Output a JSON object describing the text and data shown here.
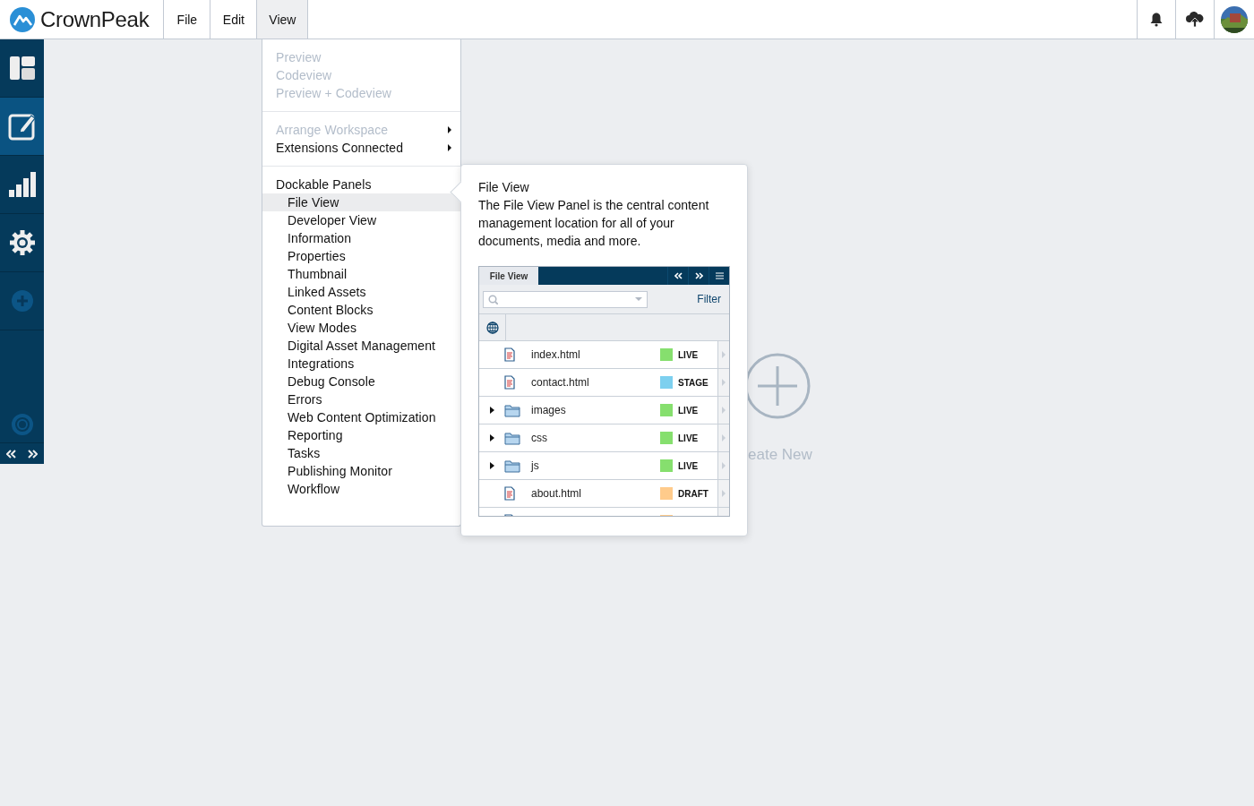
{
  "topbar": {
    "brand": "CrownPeak",
    "menus": [
      {
        "label": "File",
        "selected": false
      },
      {
        "label": "Edit",
        "selected": false
      },
      {
        "label": "View",
        "selected": true
      }
    ]
  },
  "sidebar": {
    "items": [
      {
        "kind": "dashboard",
        "selected": false
      },
      {
        "kind": "edit",
        "selected": true
      },
      {
        "kind": "analytics",
        "selected": false
      },
      {
        "kind": "settings",
        "selected": false
      },
      {
        "kind": "add",
        "selected": false
      }
    ]
  },
  "view_menu": {
    "sections": [
      {
        "items": [
          {
            "label": "Preview",
            "disabled": true,
            "submenu": false,
            "selected": false
          },
          {
            "label": "Codeview",
            "disabled": true,
            "submenu": false,
            "selected": false
          },
          {
            "label": "Preview + Codeview",
            "disabled": true,
            "submenu": false,
            "selected": false
          }
        ]
      },
      {
        "items": [
          {
            "label": "Arrange Workspace",
            "disabled": true,
            "submenu": true,
            "selected": false
          },
          {
            "label": "Extensions Connected",
            "disabled": false,
            "submenu": true,
            "selected": false
          }
        ]
      },
      {
        "items": [
          {
            "label": "Dockable Panels",
            "disabled": false,
            "submenu": false,
            "selected": false,
            "children": [
              {
                "label": "File View",
                "disabled": false,
                "submenu": false,
                "selected": true
              },
              {
                "label": "Developer View",
                "disabled": false,
                "submenu": false,
                "selected": false
              },
              {
                "label": "Information",
                "disabled": false,
                "submenu": false,
                "selected": false
              },
              {
                "label": "Properties",
                "disabled": false,
                "submenu": false,
                "selected": false
              },
              {
                "label": "Thumbnail",
                "disabled": false,
                "submenu": false,
                "selected": false
              },
              {
                "label": "Linked Assets",
                "disabled": false,
                "submenu": false,
                "selected": false
              },
              {
                "label": "Content Blocks",
                "disabled": false,
                "submenu": false,
                "selected": false
              },
              {
                "label": "View Modes",
                "disabled": false,
                "submenu": false,
                "selected": false
              },
              {
                "label": "Digital Asset Management",
                "disabled": false,
                "submenu": false,
                "selected": false
              },
              {
                "label": "Integrations",
                "disabled": false,
                "submenu": false,
                "selected": false
              },
              {
                "label": "Debug Console",
                "disabled": false,
                "submenu": false,
                "selected": false
              },
              {
                "label": "Errors",
                "disabled": false,
                "submenu": false,
                "selected": false
              },
              {
                "label": "Web Content Optimization",
                "disabled": false,
                "submenu": false,
                "selected": false
              },
              {
                "label": "Reporting",
                "disabled": false,
                "submenu": false,
                "selected": false
              },
              {
                "label": "Tasks",
                "disabled": false,
                "submenu": false,
                "selected": false
              },
              {
                "label": "Publishing Monitor",
                "disabled": false,
                "submenu": false,
                "selected": false
              },
              {
                "label": "Workflow",
                "disabled": false,
                "submenu": false,
                "selected": false
              }
            ]
          }
        ]
      }
    ]
  },
  "popover": {
    "title": "File View",
    "description": "The File View Panel is the central content management location for all of your documents, media and more.",
    "panel": {
      "tab": "File View",
      "filter": "Filter",
      "rows": [
        {
          "kind": "file",
          "name": "index.html",
          "status": "LIVE",
          "color": "#86df6e"
        },
        {
          "kind": "file",
          "name": "contact.html",
          "status": "STAGE",
          "color": "#7dd0ef"
        },
        {
          "kind": "folder",
          "name": "images",
          "status": "LIVE",
          "color": "#86df6e"
        },
        {
          "kind": "folder",
          "name": "css",
          "status": "LIVE",
          "color": "#86df6e"
        },
        {
          "kind": "folder",
          "name": "js",
          "status": "LIVE",
          "color": "#86df6e"
        },
        {
          "kind": "file",
          "name": "about.html",
          "status": "DRAFT",
          "color": "#ffcb8b"
        },
        {
          "kind": "file",
          "color": "#ffcb8b"
        }
      ]
    }
  },
  "create_new": {
    "label": "eate New"
  }
}
